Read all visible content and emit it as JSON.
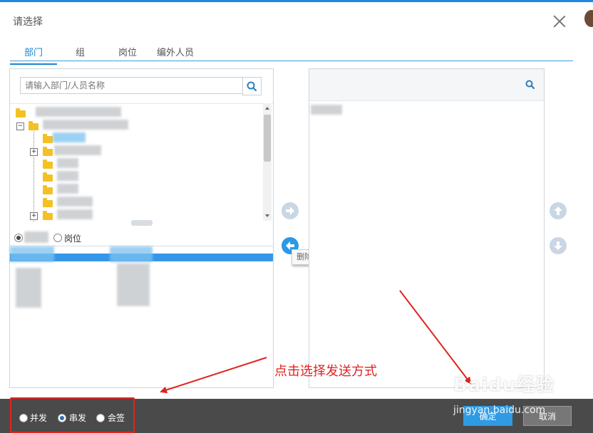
{
  "dialog": {
    "title": "请选择",
    "close_icon": "close-icon"
  },
  "tabs": [
    {
      "label": "部门",
      "active": true
    },
    {
      "label": "组",
      "active": false
    },
    {
      "label": "岗位",
      "active": false
    },
    {
      "label": "编外人员",
      "active": false
    }
  ],
  "left_panel": {
    "search_placeholder": "请输入部门/人员名称",
    "search_icon": "search-icon",
    "filter_options": [
      {
        "label": "",
        "selected": true
      },
      {
        "label": "岗位",
        "selected": false
      }
    ]
  },
  "right_panel": {
    "search_icon": "search-icon"
  },
  "transfer": {
    "add_icon": "arrow-right-icon",
    "remove_icon": "arrow-left-icon",
    "remove_tooltip": "删除",
    "move_up_icon": "arrow-up-icon",
    "move_down_icon": "arrow-down-icon"
  },
  "footer": {
    "send_modes": [
      {
        "label": "并发",
        "selected": false
      },
      {
        "label": "串发",
        "selected": true
      },
      {
        "label": "会签",
        "selected": false
      }
    ],
    "ok_label": "确定",
    "cancel_label": "取消"
  },
  "annotation": {
    "text": "点击选择发送方式",
    "color": "#e0231f"
  },
  "watermark": {
    "brand": "Baidu经验",
    "url": "jingyan.baidu.com"
  },
  "colors": {
    "accent": "#1c86d1",
    "selection": "#3597ea",
    "footer_bg": "#4a4a4a"
  }
}
